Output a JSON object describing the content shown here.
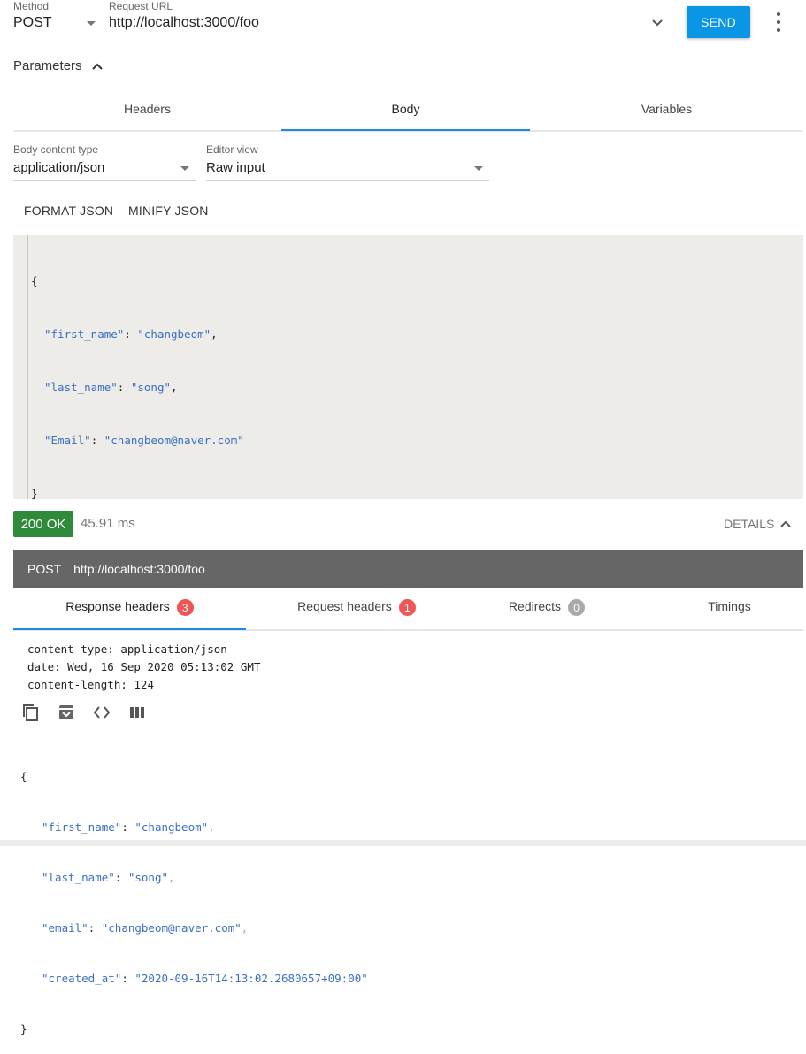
{
  "request": {
    "method_label": "Method",
    "method_value": "POST",
    "url_label": "Request URL",
    "url_value": "http://localhost:3000/foo",
    "send_label": "SEND"
  },
  "parameters": {
    "label": "Parameters"
  },
  "tabs": [
    {
      "label": "Headers"
    },
    {
      "label": "Body"
    },
    {
      "label": "Variables"
    }
  ],
  "body_options": {
    "content_type_label": "Body content type",
    "content_type_value": "application/json",
    "editor_view_label": "Editor view",
    "editor_view_value": "Raw input",
    "format_label": "FORMAT JSON",
    "minify_label": "MINIFY JSON"
  },
  "editor": {
    "open": "{",
    "fields": [
      {
        "key": "\"first_name\"",
        "value": "\"changbeom\"",
        "comma": ","
      },
      {
        "key": "\"last_name\"",
        "value": "\"song\"",
        "comma": ","
      },
      {
        "key": "\"Email\"",
        "value": "\"changbeom@naver.com\"",
        "comma": ""
      }
    ],
    "close": "}"
  },
  "response": {
    "status": "200 OK",
    "time": "45.91 ms",
    "details_label": "DETAILS",
    "bar_method": "POST",
    "bar_url": "http://localhost:3000/foo",
    "tabs": [
      {
        "label": "Response headers",
        "count": "3",
        "badge_color": "#f05454"
      },
      {
        "label": "Request headers",
        "count": "1",
        "badge_color": "#f05454"
      },
      {
        "label": "Redirects",
        "count": "0",
        "badge_color": "#a9a9a9"
      },
      {
        "label": "Timings",
        "count": "",
        "badge_color": ""
      }
    ],
    "headers": [
      "content-type: application/json",
      "date: Wed, 16 Sep 2020 05:13:02 GMT",
      "content-length: 124"
    ],
    "toolbar_icons": [
      "copy-icon",
      "save-icon",
      "code-icon",
      "columns-icon"
    ],
    "body": {
      "open": "{",
      "fields": [
        {
          "key": "\"first_name\"",
          "value": "\"changbeom\"",
          "comma": ","
        },
        {
          "key": "\"last_name\"",
          "value": "\"song\"",
          "comma": ","
        },
        {
          "key": "\"email\"",
          "value": "\"changbeom@naver.com\"",
          "comma": ","
        },
        {
          "key": "\"created_at\"",
          "value": "\"2020-09-16T14:13:02.2680657+09:00\"",
          "comma": ""
        }
      ],
      "close": "}"
    }
  },
  "colors": {
    "accent": "#0a96e4",
    "success": "#2e8b3a",
    "tab_indicator": "#1e88e5"
  }
}
